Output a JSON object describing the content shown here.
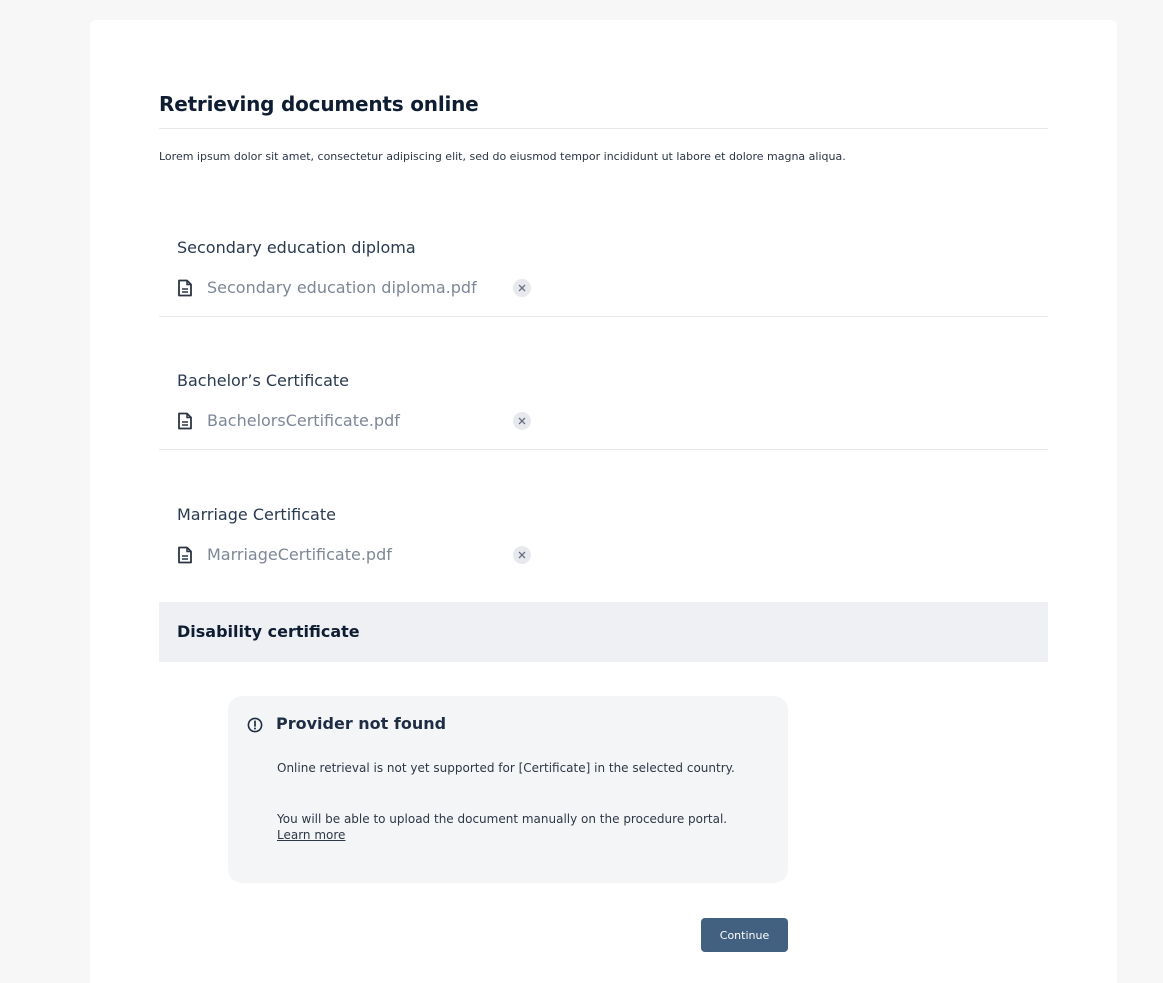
{
  "page": {
    "title": "Retrieving documents online",
    "intro": "Lorem ipsum dolor sit amet, consectetur adipiscing elit, sed do eiusmod tempor incididunt ut labore et dolore magna aliqua."
  },
  "documents": [
    {
      "title": "Secondary education diploma",
      "file_name": "Secondary education diploma.pdf",
      "file_icon": "file-icon",
      "remove_icon": "close-icon"
    },
    {
      "title": "Bachelor’s Certificate",
      "file_name": "BachelorsCertificate.pdf",
      "file_icon": "file-icon",
      "remove_icon": "close-icon"
    },
    {
      "title": "Marriage Certificate",
      "file_name": "MarriageCertificate.pdf",
      "file_icon": "file-icon",
      "remove_icon": "close-icon"
    }
  ],
  "disability": {
    "title": "Disability certificate"
  },
  "notice": {
    "icon": "alert-circle-icon",
    "title": "Provider not found",
    "text1": "Online retrieval is not yet supported for [Certificate] in the selected country.",
    "text2": "You will be able to upload the document manually on the procedure portal.",
    "link_label": "Learn more"
  },
  "actions": {
    "continue_label": "Continue"
  },
  "colors": {
    "page_background": "#f7f7f8",
    "card_background": "#ffffff",
    "primary_button": "#42607f",
    "section_highlight": "#eef0f4",
    "notice_background": "#f4f5f7",
    "muted_text": "#7e8797"
  }
}
